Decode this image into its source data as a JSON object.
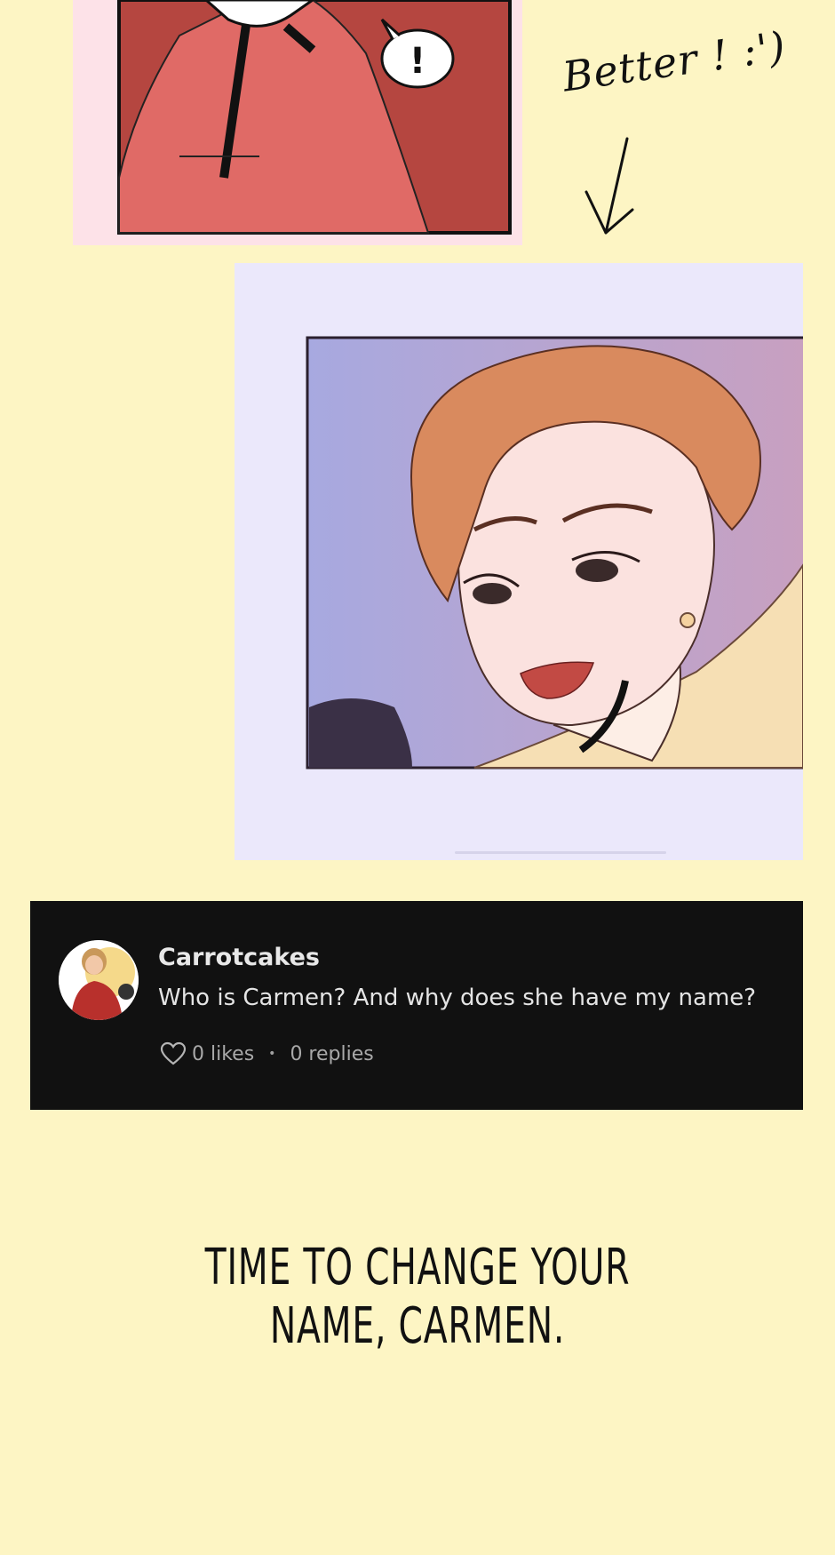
{
  "panels": {
    "top_bubble_text": "!",
    "annotation_text": "Better ! :')"
  },
  "comment": {
    "author": "Carrotcakes",
    "text": "Who is Carmen? And why does she have my name?",
    "likes": "0 likes",
    "separator": "•",
    "replies": "0 replies",
    "avatar_icon": "user-avatar"
  },
  "caption": {
    "line1": "TIME TO CHANGE YOUR",
    "line2": "NAME, CARMEN."
  },
  "colors": {
    "page_background": "#fdf5c4",
    "top_panel_frame": "#fde2e8",
    "top_panel_art": "#b54640",
    "mid_panel_frame": "#ebe8fb",
    "comment_background": "#111111"
  }
}
